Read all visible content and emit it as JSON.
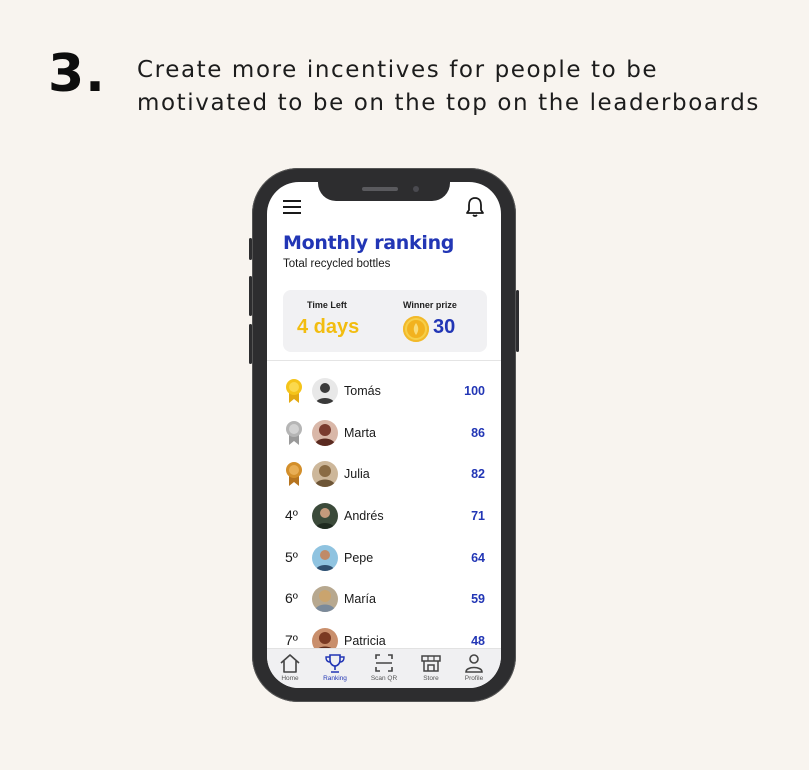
{
  "heading": {
    "number": "3.",
    "text": "Create more incentives for people to be motivated to be on the top on the leaderboards"
  },
  "app": {
    "title": "Monthly ranking",
    "subtitle": "Total recycled bottles",
    "info": {
      "time_label": "Time Left",
      "time_value": "4 days",
      "prize_label": "Winner prize",
      "prize_value": "30"
    },
    "leaderboard": [
      {
        "rank": "1",
        "medal": "gold-medal-icon",
        "name": "Tomás",
        "score": "100"
      },
      {
        "rank": "2",
        "medal": "silver-medal-icon",
        "name": "Marta",
        "score": "86"
      },
      {
        "rank": "3",
        "medal": "bronze-medal-icon",
        "name": "Julia",
        "score": "82"
      },
      {
        "rank": "4º",
        "name": "Andrés",
        "score": "71"
      },
      {
        "rank": "5º",
        "name": "Pepe",
        "score": "64"
      },
      {
        "rank": "6º",
        "name": "María",
        "score": "59"
      },
      {
        "rank": "7º",
        "name": "Patricia",
        "score": "48"
      }
    ],
    "nav": [
      {
        "label": "Home",
        "icon": "home-icon"
      },
      {
        "label": "Ranking",
        "icon": "trophy-icon",
        "active": true
      },
      {
        "label": "Scan QR",
        "icon": "scan-qr-icon"
      },
      {
        "label": "Store",
        "icon": "store-icon"
      },
      {
        "label": "Profile",
        "icon": "profile-icon"
      }
    ]
  },
  "colors": {
    "accent": "#2236b5",
    "highlight": "#f2bd10",
    "background": "#f8f4ef"
  }
}
